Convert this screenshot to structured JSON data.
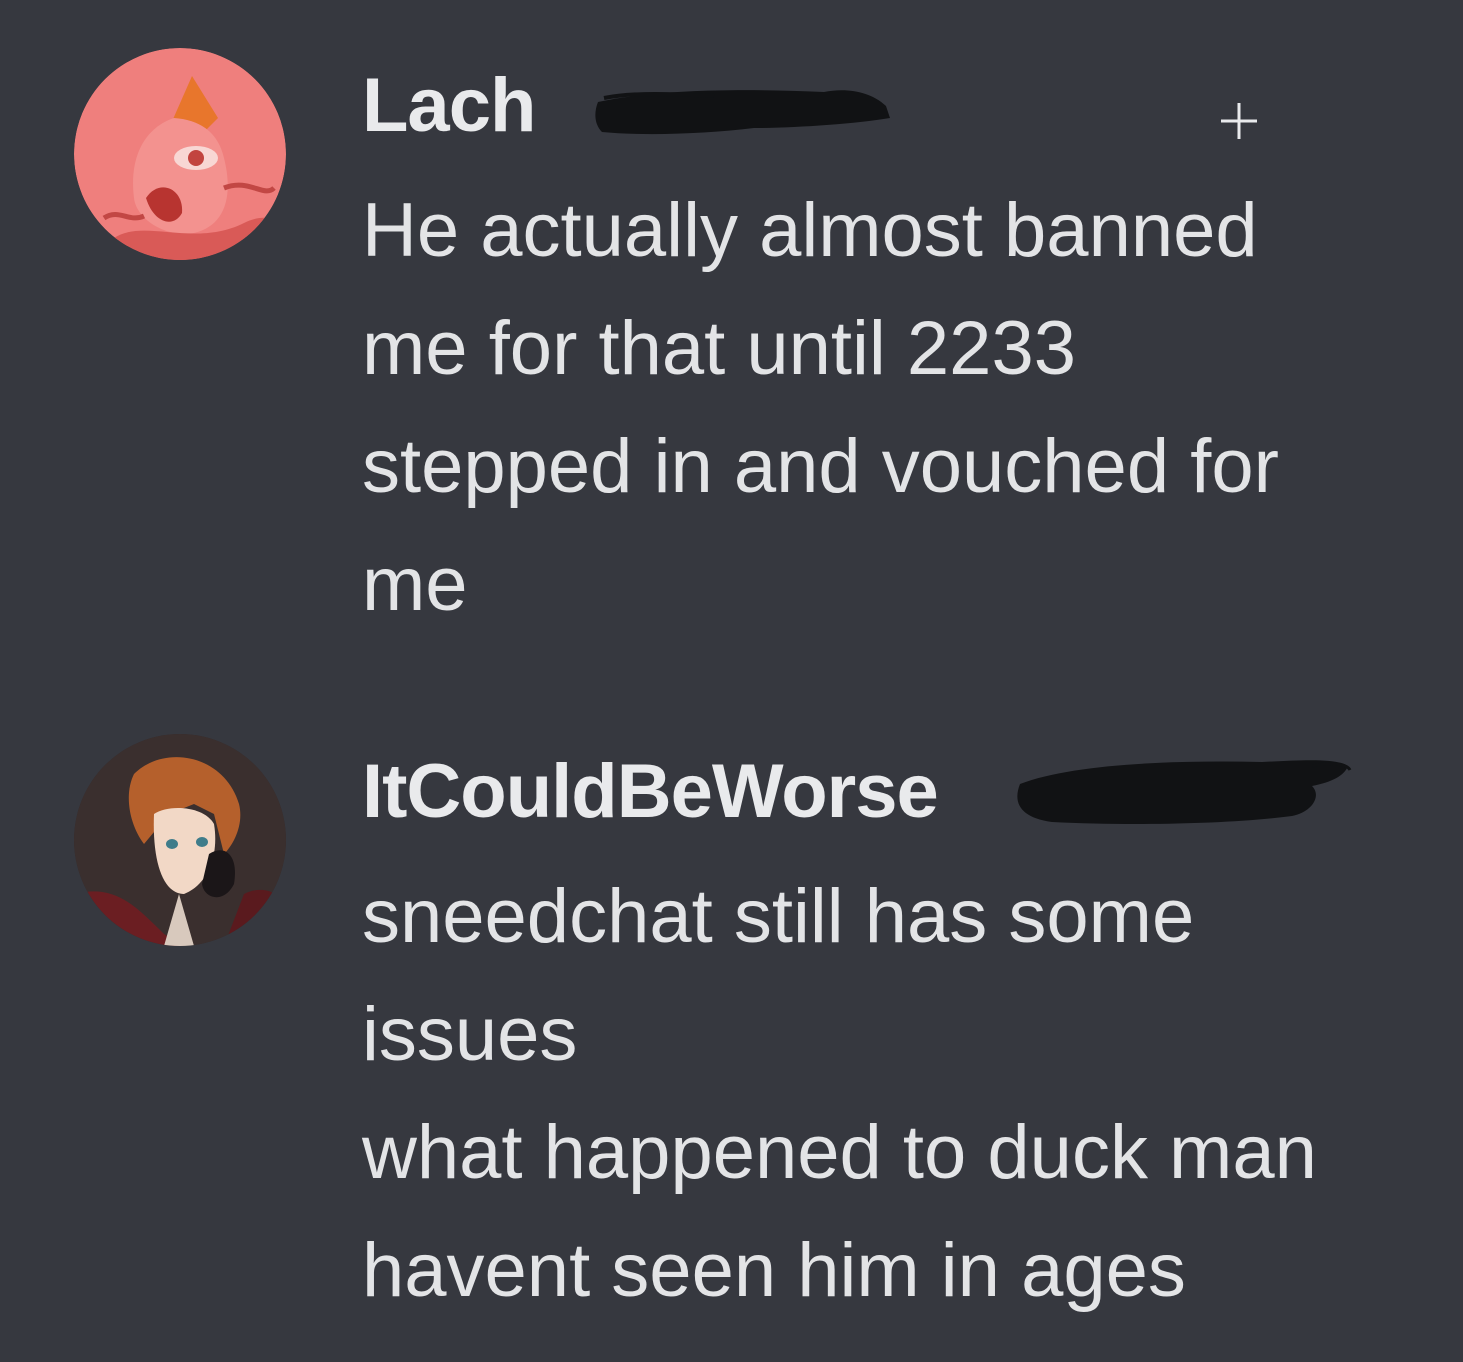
{
  "messages": [
    {
      "username": "Lach",
      "avatar": "pink-cartoon-character-avatar",
      "lines": [
        "He actually almost banned",
        "me for that until 2233",
        "stepped in and vouched for",
        "me"
      ]
    },
    {
      "username": "ItCouldBeWorse",
      "avatar": "anime-character-avatar",
      "lines": [
        "sneedchat still has some",
        "issues",
        "what happened to duck man",
        "havent seen him in ages"
      ]
    }
  ],
  "icons": {
    "add": "plus-icon"
  },
  "colors": {
    "background": "#36383f",
    "text": "#e3e4e6",
    "username": "#e9eaec",
    "redaction": "#111214",
    "avatar1": "#ef7f7d"
  }
}
